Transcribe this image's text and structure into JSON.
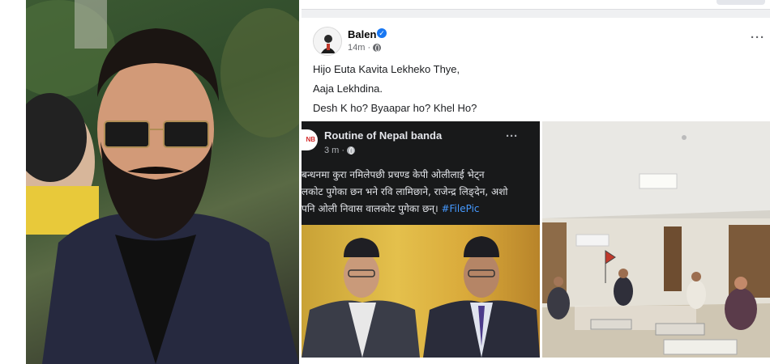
{
  "post": {
    "author": "Balen",
    "time": "14m · ",
    "lines": [
      "Hijo Euta Kavita Lekheko Thye,",
      "Aaja Lekhdina.",
      "Desh K ho? Byaapar ho? Khel Ho?"
    ],
    "more": "···"
  },
  "shared": {
    "page_name": "Routine of Nepal banda",
    "logo_text": "NB",
    "time": "3 m · ",
    "more": "···",
    "caption_lines": [
      "बन्धनमा कुरा नमिलेपछी प्रचण्ड केपी ओलीलाई भेट्न",
      "लकोट पुगेका छन भने रवि लामिछाने, राजेन्द्र लिङ्देन, अशो",
      "पनि ओली निवास वालकोट पुगेका छन्। "
    ],
    "hashtag": "#FilePic"
  },
  "colors": {
    "facebook_blue": "#1877f2",
    "link_blue": "#4599ff",
    "dark_card": "#18191a"
  }
}
